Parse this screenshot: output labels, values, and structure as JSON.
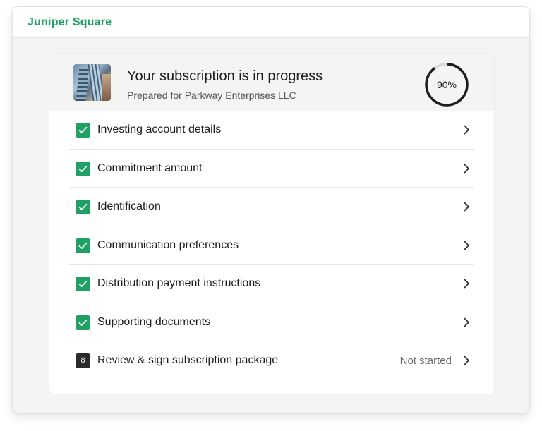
{
  "brand": {
    "name": "Juniper Square"
  },
  "card": {
    "title": "Your subscription is in progress",
    "subtitle": "Prepared for Parkway Enterprises LLC",
    "progress": {
      "value": 0.9,
      "label": "90%"
    }
  },
  "steps": [
    {
      "label": "Investing account details",
      "status": "completed",
      "status_text": ""
    },
    {
      "label": "Commitment amount",
      "status": "completed",
      "status_text": ""
    },
    {
      "label": "Identification",
      "status": "completed",
      "status_text": ""
    },
    {
      "label": "Communication preferences",
      "status": "completed",
      "status_text": ""
    },
    {
      "label": "Distribution payment instructions",
      "status": "completed",
      "status_text": ""
    },
    {
      "label": "Supporting documents",
      "status": "completed",
      "status_text": ""
    },
    {
      "label": "Review & sign subscription package",
      "status": "not-started",
      "number": "8",
      "status_text": "Not started"
    }
  ],
  "colors": {
    "accent": "#1fa163",
    "badge_dark": "#2a2a2a",
    "progress_track": "#d9d9d9",
    "progress_fill": "#1c1c1c"
  },
  "icons": {
    "check": "check-icon",
    "chevron": "chevron-right-icon",
    "thumbnail": "building-thumbnail"
  }
}
